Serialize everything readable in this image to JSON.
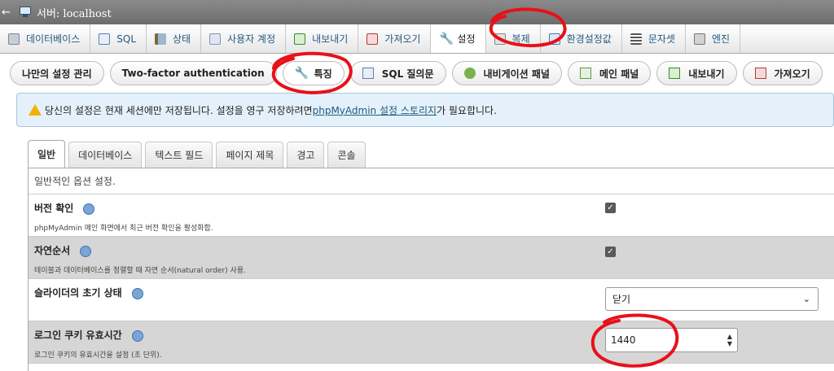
{
  "server": {
    "back_glyph": "←",
    "title": "서버: localhost"
  },
  "top_tabs": [
    {
      "label": "데이터베이스",
      "icon": "database-icon"
    },
    {
      "label": "SQL",
      "icon": "sql-icon"
    },
    {
      "label": "상태",
      "icon": "status-icon"
    },
    {
      "label": "사용자 계정",
      "icon": "user-accounts-icon"
    },
    {
      "label": "내보내기",
      "icon": "export-icon"
    },
    {
      "label": "가져오기",
      "icon": "import-icon"
    },
    {
      "label": "설정",
      "icon": "wrench-icon"
    },
    {
      "label": "복제",
      "icon": "replication-icon"
    },
    {
      "label": "환경설정값",
      "icon": "variables-icon"
    },
    {
      "label": "문자셋",
      "icon": "charset-icon"
    },
    {
      "label": "엔진",
      "icon": "engine-icon"
    }
  ],
  "sub_tabs": [
    {
      "label": "나만의 설정 관리",
      "icon": ""
    },
    {
      "label": "Two-factor authentication",
      "icon": ""
    },
    {
      "label": "특징",
      "icon": "wrench-icon"
    },
    {
      "label": "SQL 질의문",
      "icon": "sql-icon"
    },
    {
      "label": "내비게이션 패널",
      "icon": "navigation-icon"
    },
    {
      "label": "메인 패널",
      "icon": "main-panel-icon"
    },
    {
      "label": "내보내기",
      "icon": "export-icon"
    },
    {
      "label": "가져오기",
      "icon": "import-icon"
    }
  ],
  "notice": {
    "text_before": "당신의 설정은 현재 세션에만 저장됩니다. 설정을 영구 저장하려면 ",
    "link": "phpMyAdmin 설정 스토리지",
    "text_after": "가 필요합니다."
  },
  "inner_tabs": [
    "일반",
    "데이터베이스",
    "텍스트 필드",
    "페이지 제목",
    "경고",
    "콘솔"
  ],
  "panel": {
    "description": "일반적인 옵션 설정.",
    "settings": [
      {
        "label": "버전 확인",
        "desc": "phpMyAdmin 메인 화면에서 최근 버전 확인을 활성화합.",
        "type": "checkbox",
        "checked": true
      },
      {
        "label": "자연순서",
        "desc": "테이블과 데이터베이스를 정렬할 때 자연 순서(natural order) 사용.",
        "type": "checkbox",
        "checked": true
      },
      {
        "label": "슬라이더의 초기 상태",
        "desc": "",
        "type": "select",
        "value": "닫기"
      },
      {
        "label": "로그인 쿠키 유효시간",
        "desc": "로그인 쿠키의 유효시간을 설정 (초 단위).",
        "type": "number",
        "value": "1440"
      }
    ]
  },
  "colors": {
    "annotation": "#e8101a",
    "link": "#235a81",
    "notice_bg": "#e4f1fa"
  }
}
